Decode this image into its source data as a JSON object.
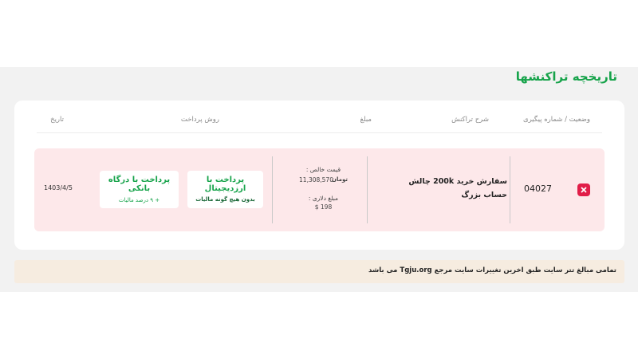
{
  "page": {
    "title": "تاریخچه تراکنشها"
  },
  "table": {
    "headers": {
      "status": "وضعیت / شماره پیگیری",
      "description": "شرح تراکنش",
      "amount": "مبلغ",
      "payment_method": "روش پرداخت",
      "date": "تاریخ"
    },
    "rows": [
      {
        "tracking_number": "04027",
        "description": "سفارش خرید 200k چالش حساب بزرگ",
        "net_price_label": "قیمت خالص :",
        "net_price_value": "11,308,570",
        "currency_unit": "تومان",
        "dollar_label": "مبلغ دلاری :",
        "dollar_value": "$ 198",
        "pay_digital_title": "پرداخت با ارزدیجیتال",
        "pay_digital_sub": "بدون هیچ گونه مالیات",
        "pay_bank_title": "پرداخت با درگاه بانکی",
        "pay_bank_sub": "+ ۹ درصد مالیات",
        "date": "1403/4/5"
      }
    ]
  },
  "notice": {
    "text": "تمامی مبالغ تتر سایت طبق اخرین تغییرات سایت مرجع Tgju.org می باشد"
  },
  "colors": {
    "accent": "#16a34a",
    "row_bg": "#fde8ea",
    "cancel": "#e11d48",
    "notice_bg": "#f6ece0"
  },
  "icons": {
    "cancel": "close-icon"
  }
}
